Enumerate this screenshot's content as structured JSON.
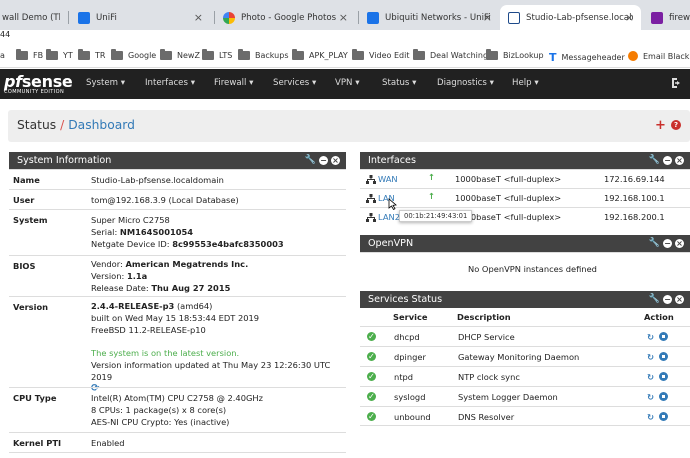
{
  "browser": {
    "tabs": [
      {
        "title": "wall Demo (The",
        "favicon_color": "#f4b400"
      },
      {
        "title": "UniFi",
        "favicon_color": "#1a73e8"
      },
      {
        "title": "Photo - Google Photos",
        "favicon_color": "#ea4335"
      },
      {
        "title": "Ubiquiti Networks - UniFi® W",
        "favicon_color": "#1a73e8"
      },
      {
        "title": "Studio-Lab-pfsense.localdom",
        "favicon_color": "#1e4a8a"
      },
      {
        "title": "firewall",
        "favicon_color": "#7b1fa2"
      }
    ],
    "address_fragment": "44",
    "bookmarks": [
      {
        "label": "a",
        "icon": "folder-icon"
      },
      {
        "label": "FB",
        "icon": "folder-icon"
      },
      {
        "label": "YT",
        "icon": "folder-icon"
      },
      {
        "label": "TR",
        "icon": "folder-icon"
      },
      {
        "label": "Google",
        "icon": "folder-icon"
      },
      {
        "label": "NewZ",
        "icon": "folder-icon"
      },
      {
        "label": "LTS",
        "icon": "folder-icon"
      },
      {
        "label": "Backups",
        "icon": "folder-icon"
      },
      {
        "label": "APK_PLAY",
        "icon": "folder-icon"
      },
      {
        "label": "Video Edit",
        "icon": "folder-icon"
      },
      {
        "label": "Deal Watching",
        "icon": "folder-icon"
      },
      {
        "label": "BizLookup",
        "icon": "folder-icon"
      },
      {
        "label": "Messageheader",
        "icon": "t-icon"
      },
      {
        "label": "Email Blacklis",
        "icon": "orange-icon"
      }
    ]
  },
  "nav": {
    "logo": {
      "pf": "pf",
      "sense": "sense",
      "edition": "COMMUNITY EDITION"
    },
    "items": [
      "System",
      "Interfaces",
      "Firewall",
      "Services",
      "VPN",
      "Status",
      "Diagnostics",
      "Help"
    ]
  },
  "breadcrumb": {
    "section": "Status",
    "separator": "/",
    "page": "Dashboard"
  },
  "system_info": {
    "title": "System Information",
    "rows": [
      {
        "label": "Name",
        "lines": [
          "Studio-Lab-pfsense.localdomain"
        ]
      },
      {
        "label": "User",
        "lines": [
          "tom@192.168.3.9 (Local Database)"
        ]
      },
      {
        "label": "System",
        "lines": [
          "Super Micro C2758"
        ],
        "serial_prefix": "Serial: ",
        "serial": "NM164S001054",
        "device_prefix": "Netgate Device ID: ",
        "device_id": "8c99553e4bafc8350003"
      },
      {
        "label": "BIOS",
        "vendor_prefix": "Vendor: ",
        "vendor": "American Megatrends Inc.",
        "version_prefix": "Version: ",
        "version": "1.1a",
        "date_prefix": "Release Date: ",
        "date": "Thu Aug 27 2015"
      },
      {
        "label": "Version",
        "version": "2.4.4-RELEASE-p3",
        "version_suffix": " (amd64)",
        "built": "built on Wed May 15 18:53:44 EDT 2019",
        "freebsd": "FreeBSD 11.2-RELEASE-p10",
        "latest": "The system is on the latest version.",
        "updated": "Version information updated at Thu May 23 12:26:30 UTC 2019"
      },
      {
        "label": "CPU Type",
        "lines": [
          "Intel(R) Atom(TM) CPU C2758 @ 2.40GHz",
          "8 CPUs: 1 package(s) x 8 core(s)",
          "AES-NI CPU Crypto: Yes (inactive)"
        ]
      },
      {
        "label": "Kernel PTI",
        "lines": [
          "Enabled"
        ]
      }
    ]
  },
  "interfaces": {
    "title": "Interfaces",
    "rows": [
      {
        "name": "WAN",
        "media": "1000baseT <full-duplex>",
        "ip": "172.16.69.144"
      },
      {
        "name": "LAN",
        "media": "1000baseT <full-duplex>",
        "ip": "192.168.100.1"
      },
      {
        "name": "LAN2",
        "media": "1000baseT <full-duplex>",
        "ip": "192.168.200.1"
      }
    ],
    "tooltip": "00:1b:21:49:43:01"
  },
  "openvpn": {
    "title": "OpenVPN",
    "empty": "No OpenVPN instances defined"
  },
  "services": {
    "title": "Services Status",
    "headers": {
      "service": "Service",
      "description": "Description",
      "action": "Action"
    },
    "rows": [
      {
        "service": "dhcpd",
        "description": "DHCP Service"
      },
      {
        "service": "dpinger",
        "description": "Gateway Monitoring Daemon"
      },
      {
        "service": "ntpd",
        "description": "NTP clock sync"
      },
      {
        "service": "syslogd",
        "description": "System Logger Daemon"
      },
      {
        "service": "unbound",
        "description": "DNS Resolver"
      }
    ]
  },
  "colors": {
    "navbar": "#212121",
    "panel_header": "#424242",
    "link": "#337ab7",
    "ok": "#4cae4c",
    "danger": "#c9302c"
  }
}
